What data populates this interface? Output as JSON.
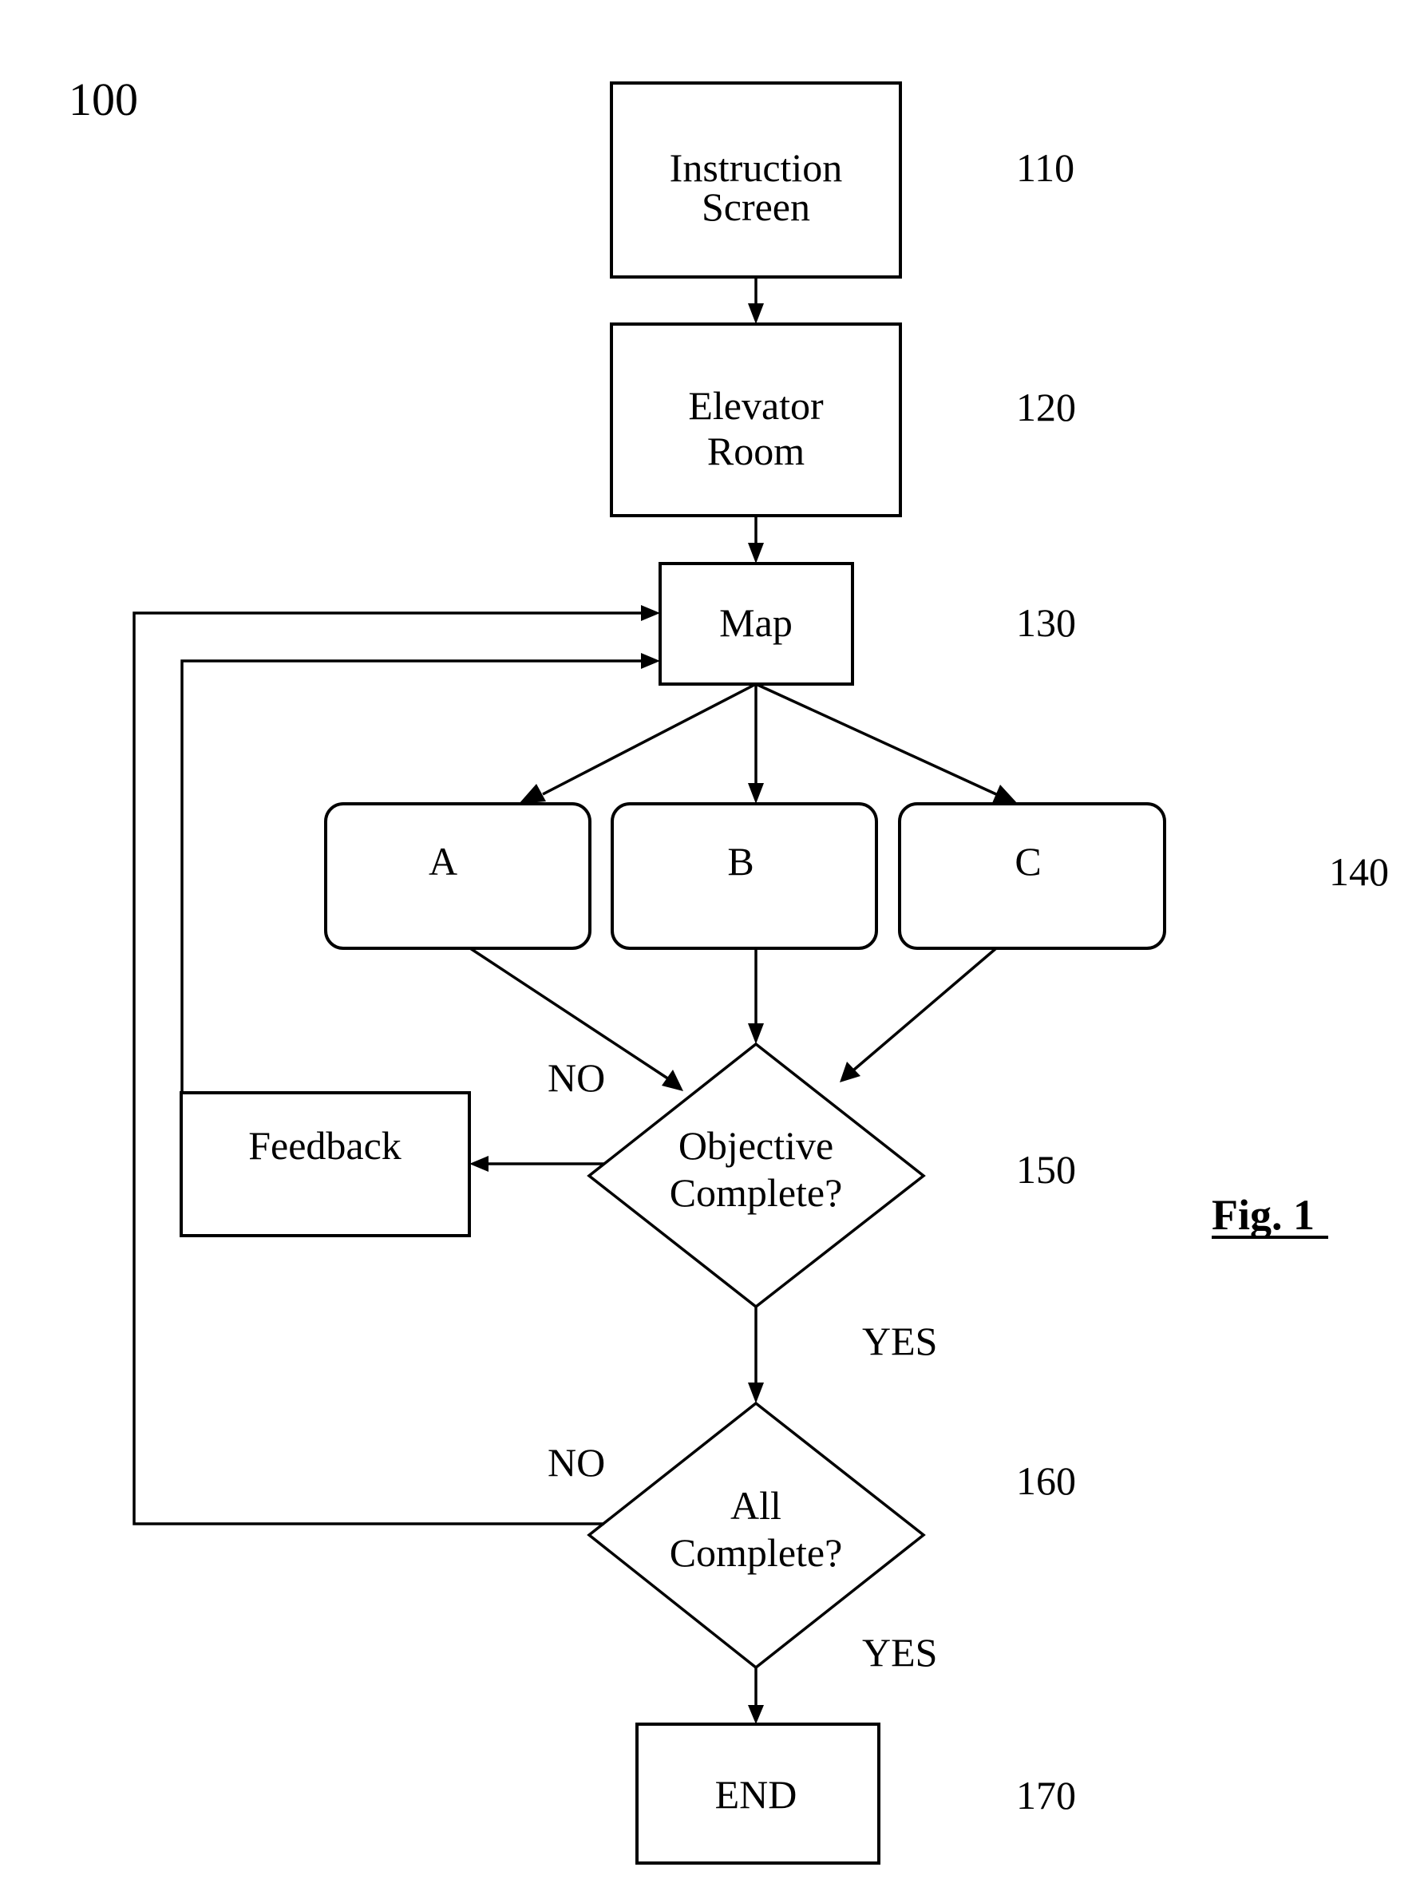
{
  "figure": {
    "reference": "100",
    "caption": "Fig. 1",
    "ink_color": "#000000",
    "background_color": "#ffffff"
  },
  "nodes": {
    "instruction_screen": {
      "lines": [
        "Instruction",
        "Screen"
      ],
      "ref": "110"
    },
    "elevator_room": {
      "lines": [
        "Elevator",
        "Room"
      ],
      "ref": "120"
    },
    "map": {
      "lines": [
        "Map"
      ],
      "ref": "130"
    },
    "options": {
      "items": [
        "A",
        "B",
        "C"
      ],
      "ref": "140"
    },
    "objective_complete": {
      "lines": [
        "Objective",
        "Complete?"
      ],
      "ref": "150"
    },
    "feedback": {
      "lines": [
        "Feedback"
      ]
    },
    "all_complete": {
      "lines": [
        "All",
        "Complete?"
      ],
      "ref": "160"
    },
    "end": {
      "lines": [
        "END"
      ],
      "ref": "170"
    }
  },
  "edge_labels": {
    "objective_no": "NO",
    "objective_yes": "YES",
    "all_no": "NO",
    "all_yes": "YES"
  },
  "edges": [
    {
      "from": "instruction_screen",
      "to": "elevator_room"
    },
    {
      "from": "elevator_room",
      "to": "map"
    },
    {
      "from": "map",
      "to": "A"
    },
    {
      "from": "map",
      "to": "B"
    },
    {
      "from": "map",
      "to": "C"
    },
    {
      "from": "A",
      "to": "objective_complete"
    },
    {
      "from": "B",
      "to": "objective_complete"
    },
    {
      "from": "C",
      "to": "objective_complete"
    },
    {
      "from": "objective_complete",
      "to": "feedback",
      "label": "NO"
    },
    {
      "from": "feedback",
      "to": "map"
    },
    {
      "from": "objective_complete",
      "to": "all_complete",
      "label": "YES"
    },
    {
      "from": "all_complete",
      "to": "map",
      "label": "NO"
    },
    {
      "from": "all_complete",
      "to": "end",
      "label": "YES"
    }
  ]
}
